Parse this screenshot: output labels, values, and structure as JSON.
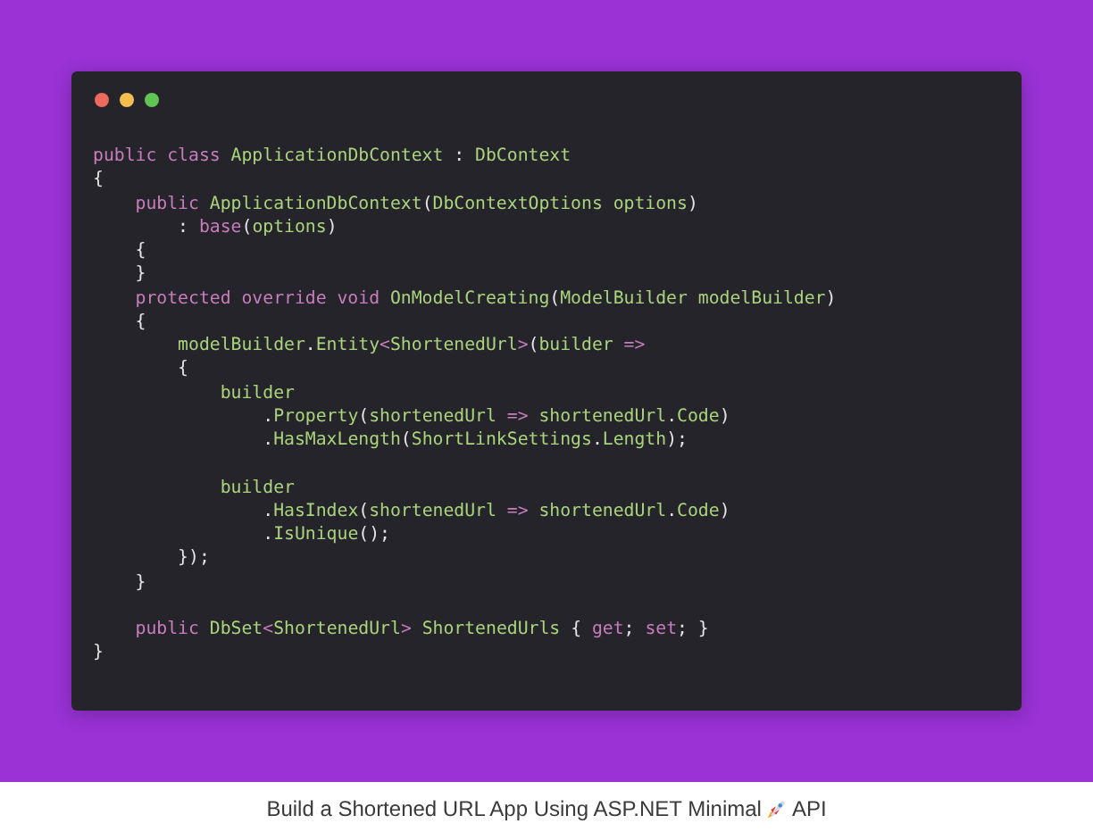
{
  "code_window": {
    "lines": [
      {
        "kind": "code",
        "tokens": [
          {
            "kind": "keyword",
            "text": "public class "
          },
          {
            "kind": "name",
            "text": "ApplicationDbContext"
          },
          {
            "kind": "plain",
            "text": " : "
          },
          {
            "kind": "name",
            "text": "DbContext"
          }
        ]
      },
      {
        "kind": "code",
        "tokens": [
          {
            "kind": "plain",
            "text": "{"
          }
        ]
      },
      {
        "kind": "code",
        "tokens": [
          {
            "kind": "keyword",
            "text": "    public "
          },
          {
            "kind": "name",
            "text": "ApplicationDbContext"
          },
          {
            "kind": "plain",
            "text": "("
          },
          {
            "kind": "name",
            "text": "DbContextOptions options"
          },
          {
            "kind": "plain",
            "text": ")"
          }
        ]
      },
      {
        "kind": "code",
        "tokens": [
          {
            "kind": "plain",
            "text": "        : "
          },
          {
            "kind": "keyword",
            "text": "base"
          },
          {
            "kind": "plain",
            "text": "("
          },
          {
            "kind": "name",
            "text": "options"
          },
          {
            "kind": "plain",
            "text": ")"
          }
        ]
      },
      {
        "kind": "code",
        "tokens": [
          {
            "kind": "plain",
            "text": "    {"
          }
        ]
      },
      {
        "kind": "code",
        "tokens": [
          {
            "kind": "plain",
            "text": "    }"
          }
        ]
      },
      {
        "kind": "code",
        "tokens": [
          {
            "kind": "keyword",
            "text": "    protected override void "
          },
          {
            "kind": "name",
            "text": "OnModelCreating"
          },
          {
            "kind": "plain",
            "text": "("
          },
          {
            "kind": "name",
            "text": "ModelBuilder modelBuilder"
          },
          {
            "kind": "plain",
            "text": ")"
          }
        ]
      },
      {
        "kind": "code",
        "tokens": [
          {
            "kind": "plain",
            "text": "    {"
          }
        ]
      },
      {
        "kind": "code",
        "tokens": [
          {
            "kind": "name",
            "text": "        modelBuilder"
          },
          {
            "kind": "plain",
            "text": "."
          },
          {
            "kind": "name",
            "text": "Entity"
          },
          {
            "kind": "keyword",
            "text": "<"
          },
          {
            "kind": "name",
            "text": "ShortenedUrl"
          },
          {
            "kind": "keyword",
            "text": ">"
          },
          {
            "kind": "plain",
            "text": "("
          },
          {
            "kind": "name",
            "text": "builder "
          },
          {
            "kind": "keyword",
            "text": "=>"
          }
        ]
      },
      {
        "kind": "code",
        "tokens": [
          {
            "kind": "plain",
            "text": "        {"
          }
        ]
      },
      {
        "kind": "code",
        "tokens": [
          {
            "kind": "name",
            "text": "            builder"
          }
        ]
      },
      {
        "kind": "code",
        "tokens": [
          {
            "kind": "plain",
            "text": "                ."
          },
          {
            "kind": "name",
            "text": "Property"
          },
          {
            "kind": "plain",
            "text": "("
          },
          {
            "kind": "name",
            "text": "shortenedUrl "
          },
          {
            "kind": "keyword",
            "text": "=>"
          },
          {
            "kind": "name",
            "text": " shortenedUrl"
          },
          {
            "kind": "plain",
            "text": "."
          },
          {
            "kind": "name",
            "text": "Code"
          },
          {
            "kind": "plain",
            "text": ")"
          }
        ]
      },
      {
        "kind": "code",
        "tokens": [
          {
            "kind": "plain",
            "text": "                ."
          },
          {
            "kind": "name",
            "text": "HasMaxLength"
          },
          {
            "kind": "plain",
            "text": "("
          },
          {
            "kind": "name",
            "text": "ShortLinkSettings"
          },
          {
            "kind": "plain",
            "text": "."
          },
          {
            "kind": "name",
            "text": "Length"
          },
          {
            "kind": "plain",
            "text": ");"
          }
        ]
      },
      {
        "kind": "blank"
      },
      {
        "kind": "code",
        "tokens": [
          {
            "kind": "name",
            "text": "            builder"
          }
        ]
      },
      {
        "kind": "code",
        "tokens": [
          {
            "kind": "plain",
            "text": "                ."
          },
          {
            "kind": "name",
            "text": "HasIndex"
          },
          {
            "kind": "plain",
            "text": "("
          },
          {
            "kind": "name",
            "text": "shortenedUrl "
          },
          {
            "kind": "keyword",
            "text": "=>"
          },
          {
            "kind": "name",
            "text": " shortenedUrl"
          },
          {
            "kind": "plain",
            "text": "."
          },
          {
            "kind": "name",
            "text": "Code"
          },
          {
            "kind": "plain",
            "text": ")"
          }
        ]
      },
      {
        "kind": "code",
        "tokens": [
          {
            "kind": "plain",
            "text": "                ."
          },
          {
            "kind": "name",
            "text": "IsUnique"
          },
          {
            "kind": "plain",
            "text": "();"
          }
        ]
      },
      {
        "kind": "code",
        "tokens": [
          {
            "kind": "plain",
            "text": "        });"
          }
        ]
      },
      {
        "kind": "code",
        "tokens": [
          {
            "kind": "plain",
            "text": "    }"
          }
        ]
      },
      {
        "kind": "blank"
      },
      {
        "kind": "code",
        "tokens": [
          {
            "kind": "keyword",
            "text": "    public "
          },
          {
            "kind": "name",
            "text": "DbSet"
          },
          {
            "kind": "keyword",
            "text": "<"
          },
          {
            "kind": "name",
            "text": "ShortenedUrl"
          },
          {
            "kind": "keyword",
            "text": "> "
          },
          {
            "kind": "name",
            "text": "ShortenedUrls "
          },
          {
            "kind": "plain",
            "text": "{ "
          },
          {
            "kind": "keyword",
            "text": "get"
          },
          {
            "kind": "plain",
            "text": "; "
          },
          {
            "kind": "keyword",
            "text": "set"
          },
          {
            "kind": "plain",
            "text": "; }"
          }
        ]
      },
      {
        "kind": "code",
        "tokens": [
          {
            "kind": "plain",
            "text": "}"
          }
        ]
      }
    ]
  },
  "caption": {
    "before_icon": "Build a Shortened URL App Using ASP.NET Minimal",
    "after_icon": "API"
  }
}
